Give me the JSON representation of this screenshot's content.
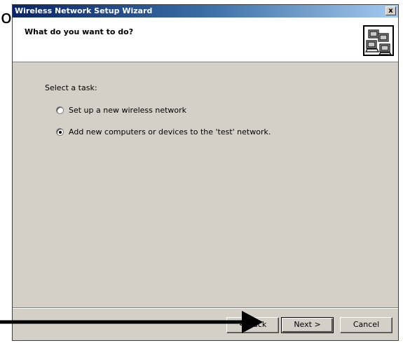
{
  "stray_char": "o",
  "window": {
    "title": "Wireless Network Setup Wizard",
    "close_label": "x"
  },
  "header": {
    "title": "What do you want to do?",
    "icon": "network-computers-icon"
  },
  "body": {
    "prompt": "Select a task:",
    "options": [
      {
        "label": "Set up a new wireless network",
        "checked": false
      },
      {
        "label": "Add new computers or devices to the 'test' network.",
        "checked": true
      }
    ]
  },
  "buttons": {
    "back": "< Back",
    "next": "Next >",
    "cancel": "Cancel"
  },
  "colors": {
    "dialog_bg": "#d4d0c8",
    "title_gradient_start": "#0a246a",
    "title_gradient_end": "#a6caf0",
    "arrow": "#000000"
  }
}
